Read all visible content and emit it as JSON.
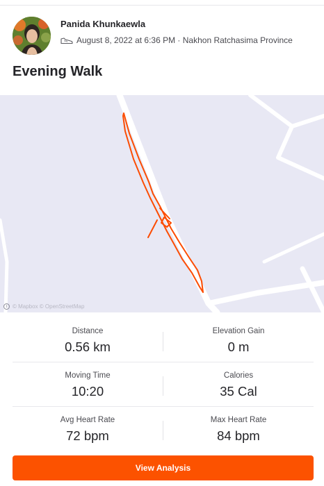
{
  "athlete": {
    "name": "Panida Khunkaewla",
    "meta": "August 8, 2022 at 6:36 PM · Nakhon Ratchasima Province"
  },
  "activity": {
    "title": "Evening Walk",
    "type_icon": "shoe-icon"
  },
  "map": {
    "attribution": "© Mapbox © OpenStreetMap",
    "route_color": "#fc4c02",
    "background_color": "#e8e8f4",
    "road_color": "#ffffff"
  },
  "stats": {
    "distance": {
      "label": "Distance",
      "value": "0.56 km"
    },
    "elevation_gain": {
      "label": "Elevation Gain",
      "value": "0 m"
    },
    "moving_time": {
      "label": "Moving Time",
      "value": "10:20"
    },
    "calories": {
      "label": "Calories",
      "value": "35 Cal"
    },
    "avg_heart_rate": {
      "label": "Avg Heart Rate",
      "value": "72 bpm"
    },
    "max_heart_rate": {
      "label": "Max Heart Rate",
      "value": "84 bpm"
    }
  },
  "actions": {
    "view_analysis": "View Analysis"
  },
  "colors": {
    "accent": "#fc5200",
    "text": "#242428"
  }
}
